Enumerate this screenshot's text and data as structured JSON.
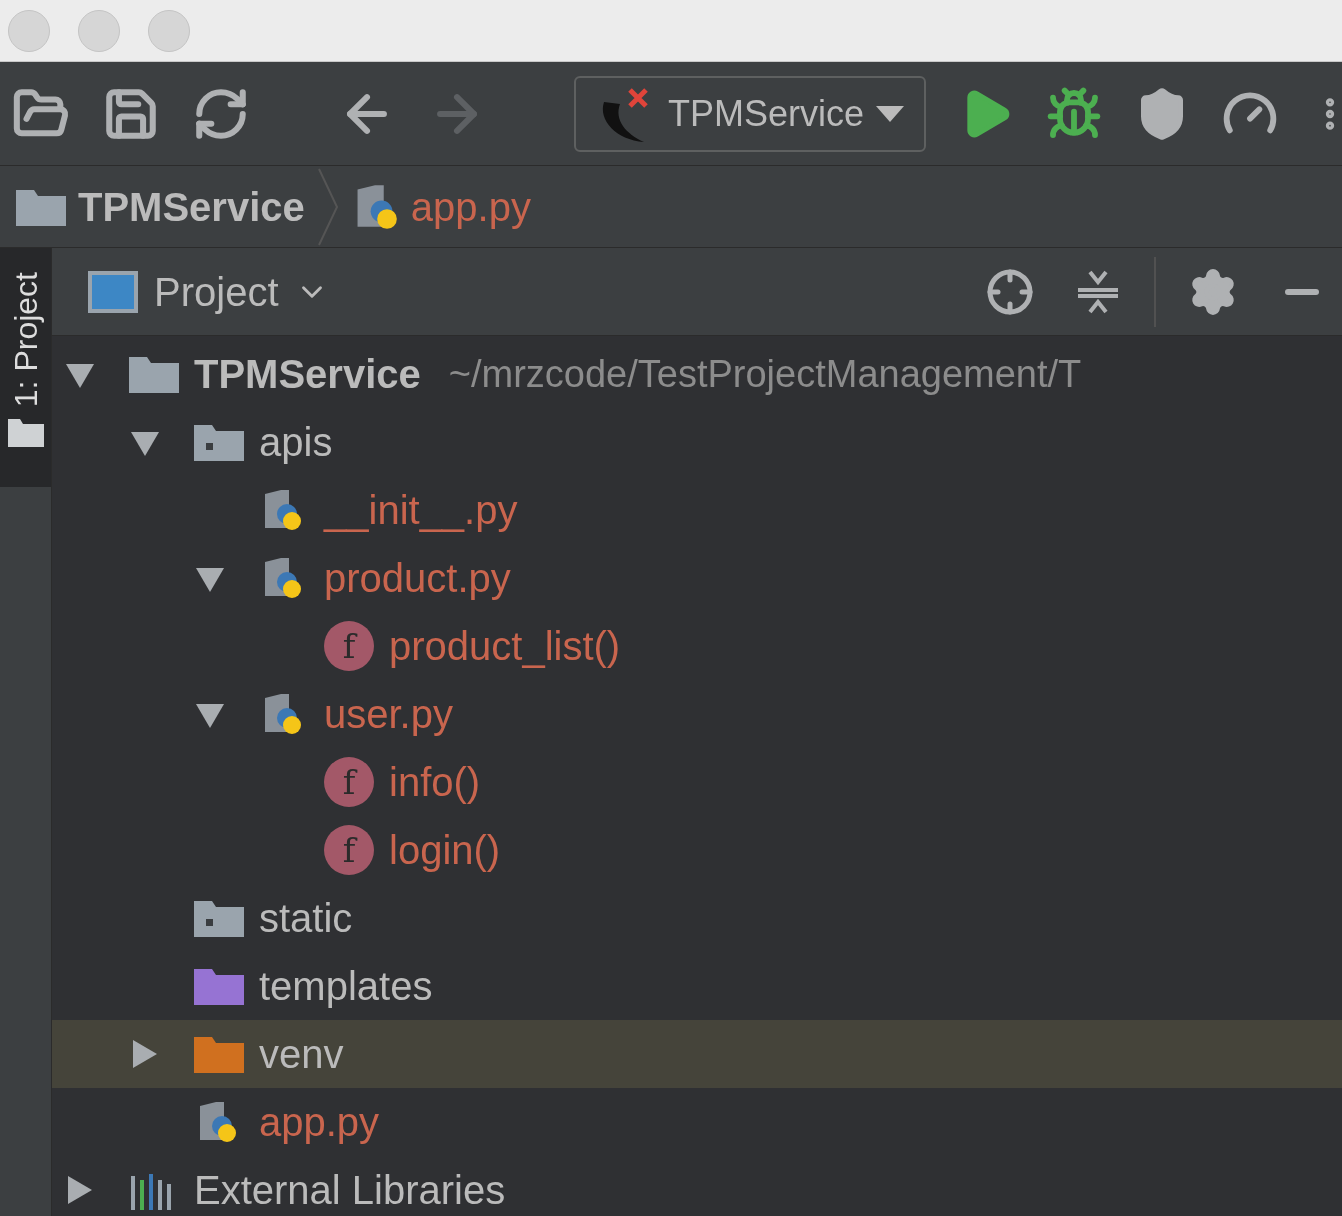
{
  "toolbar": {
    "buttons": [
      {
        "kind": "open",
        "disabled": false
      },
      {
        "kind": "save",
        "disabled": false
      },
      {
        "kind": "sync",
        "disabled": false
      },
      {
        "kind": "back",
        "disabled": false
      },
      {
        "kind": "forward",
        "disabled": true
      }
    ],
    "run_config": {
      "label": "TPMService"
    },
    "actions": [
      {
        "kind": "run"
      },
      {
        "kind": "debug"
      },
      {
        "kind": "coverage"
      },
      {
        "kind": "profile"
      },
      {
        "kind": "more"
      }
    ]
  },
  "breadcrumbs": [
    {
      "kind": "folder",
      "label": "TPMService",
      "unversioned": false
    },
    {
      "kind": "python-file",
      "label": "app.py",
      "unversioned": true
    }
  ],
  "tool_window_stripe": [
    {
      "label": "1: Project",
      "selected": true
    }
  ],
  "project_panel": {
    "view": "Project"
  },
  "tree": [
    {
      "kind": "folder",
      "label": "TPMService",
      "path": "~/mrzcode/TestProjectManagement/T",
      "expanded": true,
      "selected": false,
      "unversioned": false,
      "children": [
        {
          "kind": "source-folder",
          "label": "apis",
          "expanded": true,
          "selected": false,
          "unversioned": false,
          "children": [
            {
              "kind": "python-file",
              "label": "__init__.py",
              "selected": false,
              "unversioned": true
            },
            {
              "kind": "python-file",
              "label": "product.py",
              "expanded": true,
              "selected": false,
              "unversioned": true,
              "children": [
                {
                  "kind": "function",
                  "badge": "f",
                  "label": "product_list()",
                  "selected": false,
                  "unversioned": true
                }
              ]
            },
            {
              "kind": "python-file",
              "label": "user.py",
              "expanded": true,
              "selected": false,
              "unversioned": true,
              "children": [
                {
                  "kind": "function",
                  "badge": "f",
                  "label": "info()",
                  "selected": false,
                  "unversioned": true
                },
                {
                  "kind": "function",
                  "badge": "f",
                  "label": "login()",
                  "selected": false,
                  "unversioned": true
                }
              ]
            }
          ]
        },
        {
          "kind": "source-folder",
          "label": "static",
          "selected": false,
          "unversioned": false
        },
        {
          "kind": "templates-folder",
          "label": "templates",
          "selected": false,
          "unversioned": false
        },
        {
          "kind": "excluded-folder",
          "label": "venv",
          "expanded": false,
          "selected": true,
          "unversioned": false
        },
        {
          "kind": "python-file",
          "label": "app.py",
          "selected": false,
          "unversioned": true
        }
      ]
    },
    {
      "kind": "libraries",
      "label": "External Libraries",
      "expanded": false,
      "selected": false,
      "unversioned": false
    }
  ]
}
